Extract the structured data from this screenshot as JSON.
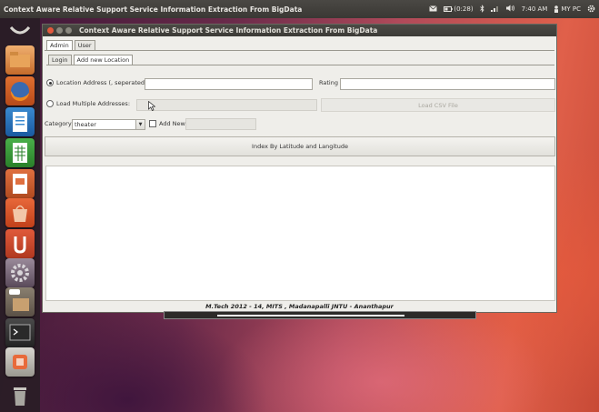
{
  "colors": {
    "panel": "#3c3b37",
    "accent_close": "#e2583d",
    "window_bg": "#efeeea",
    "desktop_warm": "#e0604a",
    "desktop_dark": "#3a1636"
  },
  "panel": {
    "title": "Context Aware Relative Support Service Information Extraction From BigData",
    "tray": {
      "mail_icon": "mail-icon",
      "battery": "(0:28)",
      "bluetooth_icon": "bluetooth-icon",
      "network_icon": "network-icon",
      "volume_icon": "volume-icon",
      "time": "7:40 AM",
      "user": "MY PC",
      "power_icon": "gear-icon"
    }
  },
  "launcher": {
    "items": [
      {
        "name": "dash-home-icon"
      },
      {
        "name": "files-icon"
      },
      {
        "name": "firefox-icon"
      },
      {
        "name": "writer-icon"
      },
      {
        "name": "calc-icon"
      },
      {
        "name": "impress-icon"
      },
      {
        "name": "software-center-icon"
      },
      {
        "name": "ubuntu-one-icon"
      },
      {
        "name": "settings-icon"
      },
      {
        "name": "workspace-icon"
      },
      {
        "name": "terminal-icon"
      },
      {
        "name": "app-icon"
      },
      {
        "name": "trash-icon"
      }
    ]
  },
  "window": {
    "title": "Context Aware Relative Support Service Information Extraction From BigData",
    "tabs": [
      "Admin",
      "User"
    ],
    "subtabs": [
      "Login",
      "Add new Location"
    ],
    "form": {
      "location_label": "Location Address (, seperated):",
      "location_value": "",
      "rating_label": "Rating",
      "rating_value": "",
      "multi_label": "Load Multiple Addresses:",
      "multi_value": "",
      "load_csv": "Load CSV File",
      "category_label": "Category",
      "category_value": "theater",
      "add_new_label": "Add New",
      "add_new_value": "",
      "index_button": "Index By Latitude and Langitude"
    },
    "footer": "M.Tech 2012 - 14, MITS , Madanapalli JNTU - Ananthapur"
  }
}
